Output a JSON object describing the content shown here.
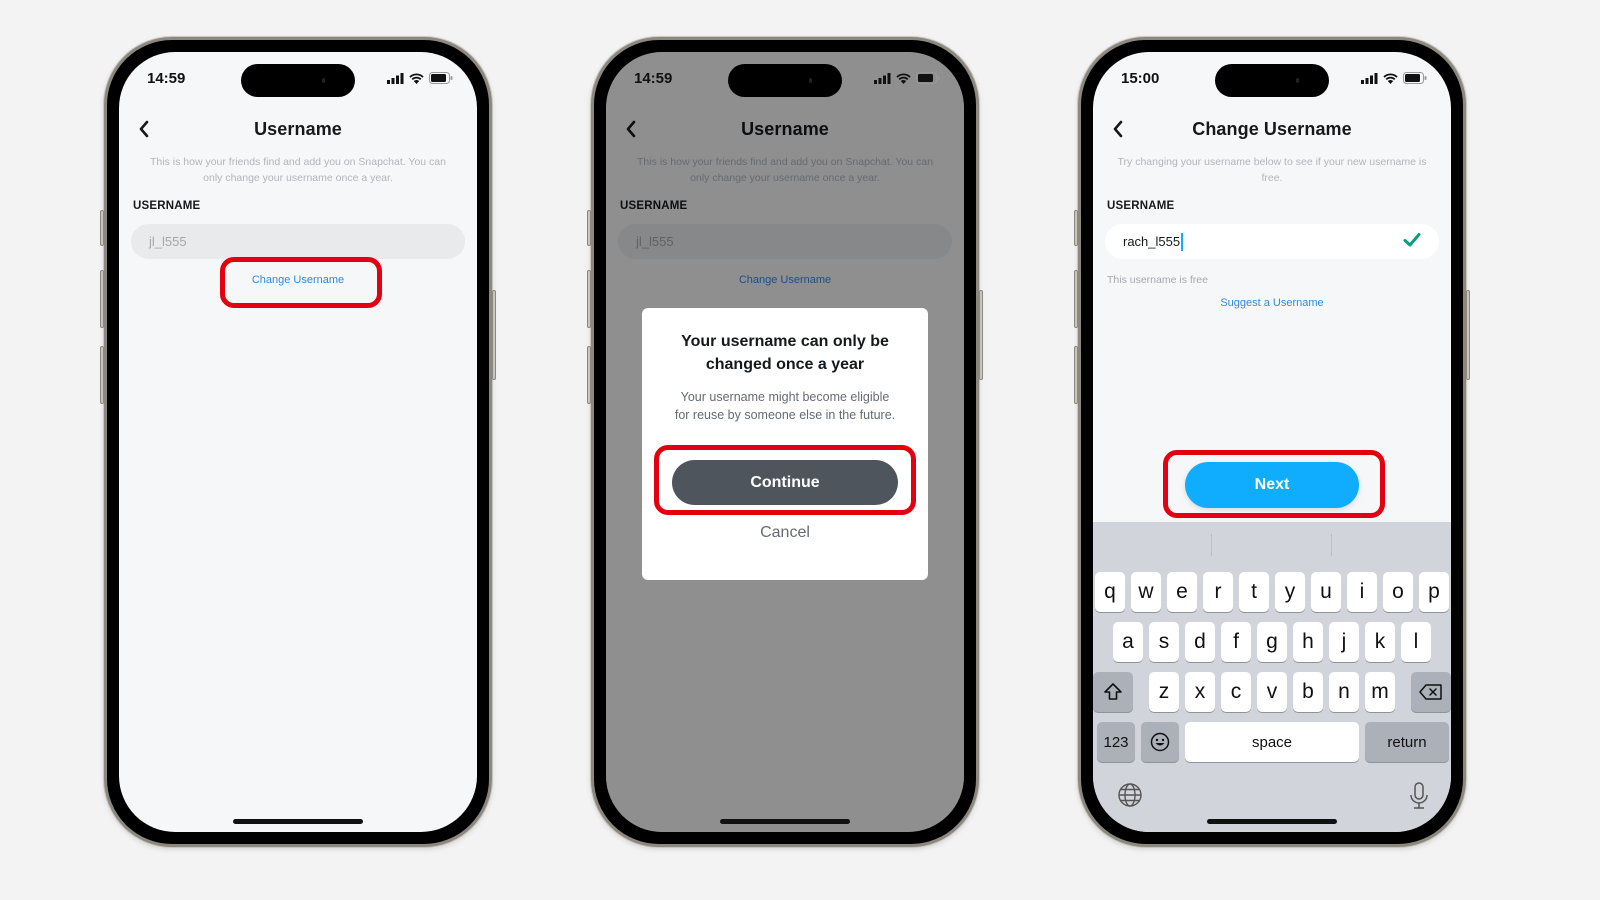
{
  "accent": {
    "annotation_red": "#e3000f",
    "link_blue": "#2f8ae0",
    "next_blue": "#10adff",
    "continue_gray": "#4f555d",
    "check_green": "#0a9e7d"
  },
  "screens": [
    {
      "status": {
        "time": "14:59",
        "icons": [
          "signal-icon",
          "wifi-icon",
          "battery-icon"
        ]
      },
      "nav": {
        "title": "Username",
        "back_icon": "chevron-left-icon"
      },
      "description": "This is how your friends find and add you on Snapchat. You can only change your username once a year.",
      "field_label": "USERNAME",
      "field_value": "jl_l555",
      "link": "Change Username",
      "highlighted": "Change Username"
    },
    {
      "status": {
        "time": "14:59",
        "icons": [
          "signal-icon",
          "wifi-icon",
          "battery-icon"
        ]
      },
      "nav": {
        "title": "Username",
        "back_icon": "chevron-left-icon"
      },
      "description": "This is how your friends find and add you on Snapchat. You can only change your username once a year.",
      "field_label": "USERNAME",
      "field_value": "jl_l555",
      "link": "Change Username",
      "dialog": {
        "title": "Your username can only be changed once a year",
        "body": "Your username might become eligible for reuse by someone else in the future.",
        "primary": "Continue",
        "secondary": "Cancel"
      },
      "highlighted": "Continue"
    },
    {
      "status": {
        "time": "15:00",
        "icons": [
          "signal-icon",
          "wifi-icon",
          "battery-icon"
        ]
      },
      "nav": {
        "title": "Change Username",
        "back_icon": "chevron-left-icon"
      },
      "description": "Try changing your username below to see if your new username is free.",
      "field_label": "USERNAME",
      "field_value": "rach_l555",
      "field_status_icon": "checkmark-icon",
      "hint": "This username is free",
      "link": "Suggest a Username",
      "next_button": "Next",
      "highlighted": "Next",
      "keyboard": {
        "row1": [
          "q",
          "w",
          "e",
          "r",
          "t",
          "y",
          "u",
          "i",
          "o",
          "p"
        ],
        "row2": [
          "a",
          "s",
          "d",
          "f",
          "g",
          "h",
          "j",
          "k",
          "l"
        ],
        "row3": [
          "z",
          "x",
          "c",
          "v",
          "b",
          "n",
          "m"
        ],
        "shift_icon": "shift-icon",
        "delete_icon": "backspace-icon",
        "numbers": "123",
        "emoji_icon": "emoji-icon",
        "space": "space",
        "return": "return",
        "globe_icon": "globe-icon",
        "mic_icon": "microphone-icon"
      }
    }
  ]
}
